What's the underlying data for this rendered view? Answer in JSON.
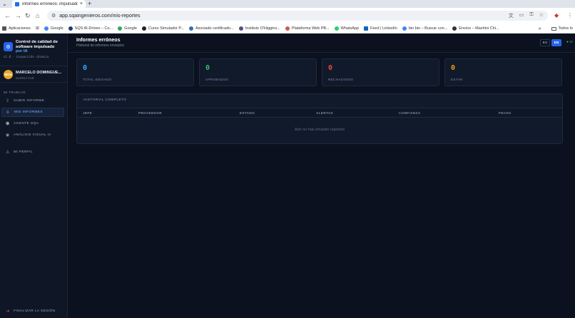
{
  "browser": {
    "tab_title": "Informes erróneos: impulsado...",
    "url": "app.sqaingenieros.com/mis-reportes",
    "bookmarks": [
      {
        "label": "Aplicaciones",
        "color": "#444444"
      },
      {
        "label": "Google",
        "color": "#4285f4"
      },
      {
        "label": "SQS AI-Driven – Co...",
        "color": "#1a3d7c"
      },
      {
        "label": "Google",
        "color": "#34a853"
      },
      {
        "label": "Curso Simulador P...",
        "color": "#222222"
      },
      {
        "label": "Asociado certificado...",
        "color": "#2f6fb3"
      },
      {
        "label": "Instituto O'Higgins...",
        "color": "#5a4b8a"
      },
      {
        "label": "Plataforma Web PB...",
        "color": "#d9534f"
      },
      {
        "label": "WhatsApp",
        "color": "#25d366"
      },
      {
        "label": "Feed | LinkedIn",
        "color": "#0a66c2"
      },
      {
        "label": "bio bio – Buscar con...",
        "color": "#4285f4"
      },
      {
        "label": "Envíos – Mashini Chi...",
        "color": "#333333"
      }
    ],
    "all_bookmarks_label": "Todos lo"
  },
  "sidebar": {
    "brand_line1": "Control de calidad de software impulsado",
    "brand_line2": "por IA",
    "version": "v1.0 · inspección cósmica",
    "user": {
      "initials": "MGS",
      "name": "MARCELO DOMINGUE...",
      "role": "INSPECTOR"
    },
    "section": "MI TRABAJO",
    "items": [
      {
        "label": "SUBIR INFORME",
        "icon": "upload-icon",
        "glyph": "⇪"
      },
      {
        "label": "MIS INFORMES",
        "icon": "list-icon",
        "glyph": "≡"
      },
      {
        "label": "AGENTE SQA",
        "icon": "agent-icon",
        "glyph": "⬢"
      },
      {
        "label": "ANÁLISIS VISUAL IA",
        "icon": "camera-icon",
        "glyph": "◉"
      },
      {
        "label": "MI PERFIL",
        "icon": "user-icon",
        "glyph": "♙"
      }
    ],
    "logout": "FINALIZAR LA SESIÓN"
  },
  "header": {
    "title": "Informes erróneos",
    "subtitle": "Historial de informes enviados",
    "lang_es": "ES",
    "lang_en": "EN",
    "status": "● VI"
  },
  "stats": [
    {
      "value": "0",
      "label": "TOTAL ENVIADO",
      "color": "#3aa6ff"
    },
    {
      "value": "0",
      "label": "APROBADOS",
      "color": "#2fbf71"
    },
    {
      "value": "0",
      "label": "RECHAZADOS",
      "color": "#ef4444"
    },
    {
      "value": "0",
      "label": "ESTAR",
      "color": "#f59e0b"
    }
  ],
  "history": {
    "title": "HISTORIAL COMPLETO",
    "columns": [
      "JEFE",
      "PROVEEDOR",
      "ESTADO",
      "ALERTAS",
      "CONFIANZA",
      "FECHA"
    ],
    "empty": "Aún no has enviado reportes"
  }
}
